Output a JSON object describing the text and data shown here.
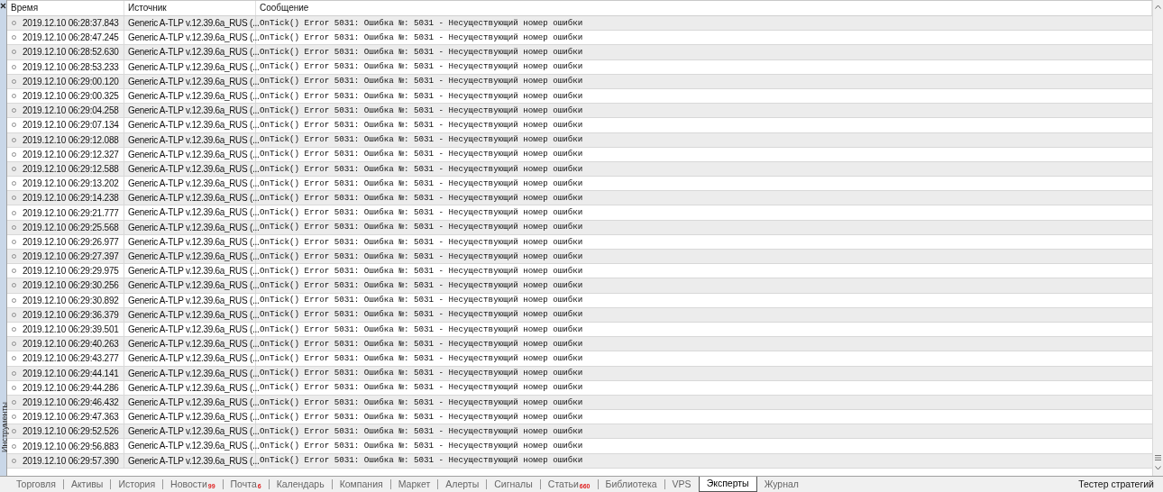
{
  "side_panel_label": "Инструменты",
  "table": {
    "columns": [
      "Время",
      "Источник",
      "Сообщение"
    ],
    "rows": [
      {
        "time": "2019.12.10 06:28:37.843",
        "source": "Generic A-TLP v.12.39.6a_RUS (...",
        "message": "OnTick() Error 5031: Ошибка №: 5031 - Несуществующий номер ошибки"
      },
      {
        "time": "2019.12.10 06:28:47.245",
        "source": "Generic A-TLP v.12.39.6a_RUS (...",
        "message": "OnTick() Error 5031: Ошибка №: 5031 - Несуществующий номер ошибки"
      },
      {
        "time": "2019.12.10 06:28:52.630",
        "source": "Generic A-TLP v.12.39.6a_RUS (...",
        "message": "OnTick() Error 5031: Ошибка №: 5031 - Несуществующий номер ошибки"
      },
      {
        "time": "2019.12.10 06:28:53.233",
        "source": "Generic A-TLP v.12.39.6a_RUS (...",
        "message": "OnTick() Error 5031: Ошибка №: 5031 - Несуществующий номер ошибки"
      },
      {
        "time": "2019.12.10 06:29:00.120",
        "source": "Generic A-TLP v.12.39.6a_RUS (...",
        "message": "OnTick() Error 5031: Ошибка №: 5031 - Несуществующий номер ошибки"
      },
      {
        "time": "2019.12.10 06:29:00.325",
        "source": "Generic A-TLP v.12.39.6a_RUS (...",
        "message": "OnTick() Error 5031: Ошибка №: 5031 - Несуществующий номер ошибки"
      },
      {
        "time": "2019.12.10 06:29:04.258",
        "source": "Generic A-TLP v.12.39.6a_RUS (...",
        "message": "OnTick() Error 5031: Ошибка №: 5031 - Несуществующий номер ошибки"
      },
      {
        "time": "2019.12.10 06:29:07.134",
        "source": "Generic A-TLP v.12.39.6a_RUS (...",
        "message": "OnTick() Error 5031: Ошибка №: 5031 - Несуществующий номер ошибки"
      },
      {
        "time": "2019.12.10 06:29:12.088",
        "source": "Generic A-TLP v.12.39.6a_RUS (...",
        "message": "OnTick() Error 5031: Ошибка №: 5031 - Несуществующий номер ошибки"
      },
      {
        "time": "2019.12.10 06:29:12.327",
        "source": "Generic A-TLP v.12.39.6a_RUS (...",
        "message": "OnTick() Error 5031: Ошибка №: 5031 - Несуществующий номер ошибки"
      },
      {
        "time": "2019.12.10 06:29:12.588",
        "source": "Generic A-TLP v.12.39.6a_RUS (...",
        "message": "OnTick() Error 5031: Ошибка №: 5031 - Несуществующий номер ошибки"
      },
      {
        "time": "2019.12.10 06:29:13.202",
        "source": "Generic A-TLP v.12.39.6a_RUS (...",
        "message": "OnTick() Error 5031: Ошибка №: 5031 - Несуществующий номер ошибки"
      },
      {
        "time": "2019.12.10 06:29:14.238",
        "source": "Generic A-TLP v.12.39.6a_RUS (...",
        "message": "OnTick() Error 5031: Ошибка №: 5031 - Несуществующий номер ошибки"
      },
      {
        "time": "2019.12.10 06:29:21.777",
        "source": "Generic A-TLP v.12.39.6a_RUS (...",
        "message": "OnTick() Error 5031: Ошибка №: 5031 - Несуществующий номер ошибки"
      },
      {
        "time": "2019.12.10 06:29:25.568",
        "source": "Generic A-TLP v.12.39.6a_RUS (...",
        "message": "OnTick() Error 5031: Ошибка №: 5031 - Несуществующий номер ошибки"
      },
      {
        "time": "2019.12.10 06:29:26.977",
        "source": "Generic A-TLP v.12.39.6a_RUS (...",
        "message": "OnTick() Error 5031: Ошибка №: 5031 - Несуществующий номер ошибки"
      },
      {
        "time": "2019.12.10 06:29:27.397",
        "source": "Generic A-TLP v.12.39.6a_RUS (...",
        "message": "OnTick() Error 5031: Ошибка №: 5031 - Несуществующий номер ошибки"
      },
      {
        "time": "2019.12.10 06:29:29.975",
        "source": "Generic A-TLP v.12.39.6a_RUS (...",
        "message": "OnTick() Error 5031: Ошибка №: 5031 - Несуществующий номер ошибки"
      },
      {
        "time": "2019.12.10 06:29:30.256",
        "source": "Generic A-TLP v.12.39.6a_RUS (...",
        "message": "OnTick() Error 5031: Ошибка №: 5031 - Несуществующий номер ошибки"
      },
      {
        "time": "2019.12.10 06:29:30.892",
        "source": "Generic A-TLP v.12.39.6a_RUS (...",
        "message": "OnTick() Error 5031: Ошибка №: 5031 - Несуществующий номер ошибки"
      },
      {
        "time": "2019.12.10 06:29:36.379",
        "source": "Generic A-TLP v.12.39.6a_RUS (...",
        "message": "OnTick() Error 5031: Ошибка №: 5031 - Несуществующий номер ошибки"
      },
      {
        "time": "2019.12.10 06:29:39.501",
        "source": "Generic A-TLP v.12.39.6a_RUS (...",
        "message": "OnTick() Error 5031: Ошибка №: 5031 - Несуществующий номер ошибки"
      },
      {
        "time": "2019.12.10 06:29:40.263",
        "source": "Generic A-TLP v.12.39.6a_RUS (...",
        "message": "OnTick() Error 5031: Ошибка №: 5031 - Несуществующий номер ошибки"
      },
      {
        "time": "2019.12.10 06:29:43.277",
        "source": "Generic A-TLP v.12.39.6a_RUS (...",
        "message": "OnTick() Error 5031: Ошибка №: 5031 - Несуществующий номер ошибки"
      },
      {
        "time": "2019.12.10 06:29:44.141",
        "source": "Generic A-TLP v.12.39.6a_RUS (...",
        "message": "OnTick() Error 5031: Ошибка №: 5031 - Несуществующий номер ошибки"
      },
      {
        "time": "2019.12.10 06:29:44.286",
        "source": "Generic A-TLP v.12.39.6a_RUS (...",
        "message": "OnTick() Error 5031: Ошибка №: 5031 - Несуществующий номер ошибки"
      },
      {
        "time": "2019.12.10 06:29:46.432",
        "source": "Generic A-TLP v.12.39.6a_RUS (...",
        "message": "OnTick() Error 5031: Ошибка №: 5031 - Несуществующий номер ошибки"
      },
      {
        "time": "2019.12.10 06:29:47.363",
        "source": "Generic A-TLP v.12.39.6a_RUS (...",
        "message": "OnTick() Error 5031: Ошибка №: 5031 - Несуществующий номер ошибки"
      },
      {
        "time": "2019.12.10 06:29:52.526",
        "source": "Generic A-TLP v.12.39.6a_RUS (...",
        "message": "OnTick() Error 5031: Ошибка №: 5031 - Несуществующий номер ошибки"
      },
      {
        "time": "2019.12.10 06:29:56.883",
        "source": "Generic A-TLP v.12.39.6a_RUS (...",
        "message": "OnTick() Error 5031: Ошибка №: 5031 - Несуществующий номер ошибки"
      },
      {
        "time": "2019.12.10 06:29:57.390",
        "source": "Generic A-TLP v.12.39.6a_RUS (...",
        "message": "OnTick() Error 5031: Ошибка №: 5031 - Несуществующий номер ошибки"
      }
    ]
  },
  "tabs": [
    {
      "label": "Торговля",
      "selected": false
    },
    {
      "label": "Активы",
      "selected": false
    },
    {
      "label": "История",
      "selected": false
    },
    {
      "label": "Новости",
      "badge": "99",
      "selected": false
    },
    {
      "label": "Почта",
      "badge": "6",
      "selected": false
    },
    {
      "label": "Календарь",
      "selected": false
    },
    {
      "label": "Компания",
      "selected": false
    },
    {
      "label": "Маркет",
      "selected": false
    },
    {
      "label": "Алерты",
      "selected": false
    },
    {
      "label": "Сигналы",
      "selected": false
    },
    {
      "label": "Статьи",
      "badge": "660",
      "selected": false
    },
    {
      "label": "Библиотека",
      "selected": false
    },
    {
      "label": "VPS",
      "selected": false
    },
    {
      "label": "Эксперты",
      "selected": true
    },
    {
      "label": "Журнал",
      "selected": false
    }
  ],
  "strategy_tester_tab": "Тестер стратегий"
}
